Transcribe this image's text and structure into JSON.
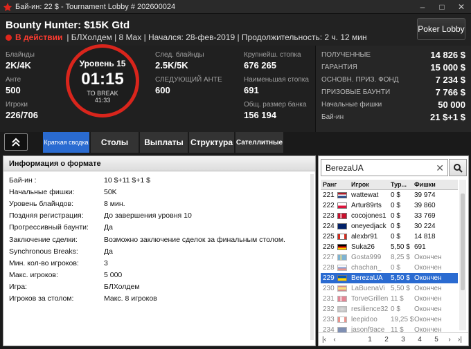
{
  "window": {
    "title": "Бай-ин: 22 $ - Tournament Lobby # 202600024",
    "controls": [
      "–",
      "□",
      "✕"
    ]
  },
  "header": {
    "tournament_name": "Bounty Hunter: $15K Gtd",
    "status": "В действии",
    "details": "| БЛХолдем | 8 Max | Начался: 28-фев-2019 | Продолжительность: 2 ч. 12 мин",
    "lobby_button": "Poker Lobby"
  },
  "stats": {
    "blinds_label": "Блайнды",
    "blinds": "2K/4K",
    "ante_label": "Анте",
    "ante": "500",
    "players_label": "Игроки",
    "players": "226/706",
    "next_blinds_label": "След. блайнды",
    "next_blinds": "2.5K/5K",
    "next_ante_label": "СЛЕДУЮЩИЙ АНТЕ",
    "next_ante": "600",
    "largest_stack_label": "Крупнейш. стопка",
    "largest_stack": "676 265",
    "smallest_stack_label": "Наименьшая стопка",
    "smallest_stack": "691",
    "bank_label": "Общ. размер банка",
    "bank": "156 194"
  },
  "clock": {
    "level": "Уровень 15",
    "time": "01:15",
    "break_label": "TO BREAK",
    "break_time": "41:33"
  },
  "prizes": [
    {
      "label": "ПОЛУЧЕННЫЕ",
      "value": "14 826 $"
    },
    {
      "label": "ГАРАНТИЯ",
      "value": "15 000 $"
    },
    {
      "label": "ОСНОВН. ПРИЗ. ФОНД",
      "value": "7 234 $"
    },
    {
      "label": "ПРИЗОВЫЕ БАУНТИ",
      "value": "7 766 $"
    },
    {
      "label": "Начальные фишки",
      "value": "50 000"
    },
    {
      "label": "Бай-ин",
      "value": "21 $+1 $"
    }
  ],
  "tabs": [
    "Краткая сводка",
    "Столы",
    "Выплаты",
    "Структура",
    "Сателлитные"
  ],
  "info": {
    "heading": "Информация о формате",
    "rows": [
      {
        "k": "Бай-ин :",
        "v": "10 $+11 $+1 $"
      },
      {
        "k": "Начальные фишки:",
        "v": "50K"
      },
      {
        "k": "Уровень блайндов:",
        "v": "8 мин."
      },
      {
        "k": "Поздняя регистрация:",
        "v": "До завершения уровня 10"
      },
      {
        "k": "Прогрессивный баунти:",
        "v": "Да"
      },
      {
        "k": "Заключение сделки:",
        "v": "Возможно заключение сделок за финальным столом."
      },
      {
        "k": "Synchronous Breaks:",
        "v": "Да"
      },
      {
        "k": "Мин. кол-во игроков:",
        "v": "3"
      },
      {
        "k": "Макс. игроков:",
        "v": "5 000"
      },
      {
        "k": "Игра:",
        "v": "БЛХолдем"
      },
      {
        "k": "Игроков за столом:",
        "v": "Макс. 8 игроков"
      }
    ]
  },
  "players": {
    "search_value": "BerezaUA",
    "headers": [
      "Ранг",
      "",
      "Игрок",
      "Тур...",
      "Фишки"
    ],
    "rows": [
      {
        "rank": "221",
        "name": "wattewat",
        "buy": "0 $",
        "chips": "39 974",
        "flag": "nl",
        "state": "normal"
      },
      {
        "rank": "222",
        "name": "Artur89rts",
        "buy": "0 $",
        "chips": "39 860",
        "flag": "pl",
        "state": "normal"
      },
      {
        "rank": "223",
        "name": "cocojones1",
        "buy": "0 $",
        "chips": "33 769",
        "flag": "dk",
        "state": "normal"
      },
      {
        "rank": "224",
        "name": "oneyedjack",
        "buy": "0 $",
        "chips": "30 224",
        "flag": "gb",
        "state": "normal"
      },
      {
        "rank": "225",
        "name": "alexbr91",
        "buy": "0 $",
        "chips": "14 818",
        "flag": "ca",
        "state": "normal"
      },
      {
        "rank": "226",
        "name": "Suka26",
        "buy": "5,50 $",
        "chips": "691",
        "flag": "de",
        "state": "normal"
      },
      {
        "rank": "227",
        "name": "Gosta999",
        "buy": "8,25 $",
        "chips": "Окончен",
        "flag": "se",
        "state": "gray"
      },
      {
        "rank": "228",
        "name": "chachan_",
        "buy": "0 $",
        "chips": "Окончен",
        "flag": "ru",
        "state": "gray"
      },
      {
        "rank": "229",
        "name": "BerezaUA",
        "buy": "5,50 $",
        "chips": "Окончен",
        "flag": "ua",
        "state": "sel"
      },
      {
        "rank": "230",
        "name": "LaBuenaVi",
        "buy": "5,50 $",
        "chips": "Окончен",
        "flag": "es",
        "state": "gray"
      },
      {
        "rank": "231",
        "name": "TorveGrillen",
        "buy": "11 $",
        "chips": "Окончен",
        "flag": "dk",
        "state": "gray"
      },
      {
        "rank": "232",
        "name": "resilience32",
        "buy": "0 $",
        "chips": "Окончен",
        "flag": "globe",
        "state": "gray"
      },
      {
        "rank": "233",
        "name": "leepidoo",
        "buy": "19,25 $",
        "chips": "Окончен",
        "flag": "ca",
        "state": "gray"
      },
      {
        "rank": "234",
        "name": "jasonf9ace",
        "buy": "11 $",
        "chips": "Окончен",
        "flag": "gb",
        "state": "gray"
      }
    ],
    "pager": [
      "1",
      "2",
      "3",
      "4",
      "5"
    ]
  },
  "colors": {
    "accent_blue": "#2a6bd1",
    "status_red": "#ff3b30",
    "clock_ring": "#d9251c"
  }
}
